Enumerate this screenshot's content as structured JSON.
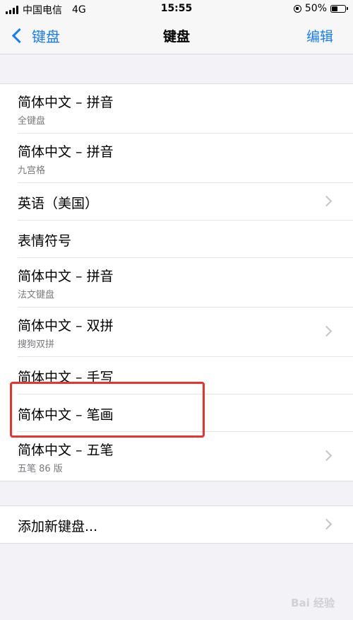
{
  "status_bar": {
    "carrier": "中国电信",
    "network": "4G",
    "time": "15:55",
    "battery_percent": "50%",
    "battery_level": 0.5
  },
  "nav": {
    "back_label": "键盘",
    "title": "键盘",
    "edit_label": "编辑"
  },
  "keyboards": [
    {
      "title": "简体中文 – 拼音",
      "subtitle": "全键盘",
      "chevron": false
    },
    {
      "title": "简体中文 – 拼音",
      "subtitle": "九宫格",
      "chevron": false
    },
    {
      "title": "英语（美国）",
      "subtitle": "",
      "chevron": true
    },
    {
      "title": "表情符号",
      "subtitle": "",
      "chevron": false
    },
    {
      "title": "简体中文 – 拼音",
      "subtitle": "法文键盘",
      "chevron": false
    },
    {
      "title": "简体中文 – 双拼",
      "subtitle": "搜狗双拼",
      "chevron": true
    },
    {
      "title": "简体中文 – 手写",
      "subtitle": "",
      "chevron": false
    },
    {
      "title": "简体中文 – 笔画",
      "subtitle": "",
      "chevron": false
    },
    {
      "title": "简体中文 – 五笔",
      "subtitle": "五笔 86 版",
      "chevron": true
    }
  ],
  "add_keyboard": {
    "label": "添加新键盘..."
  },
  "highlight_color": "#e8332e",
  "accent_color": "#1a7cf5",
  "watermark": "Bai 经验"
}
